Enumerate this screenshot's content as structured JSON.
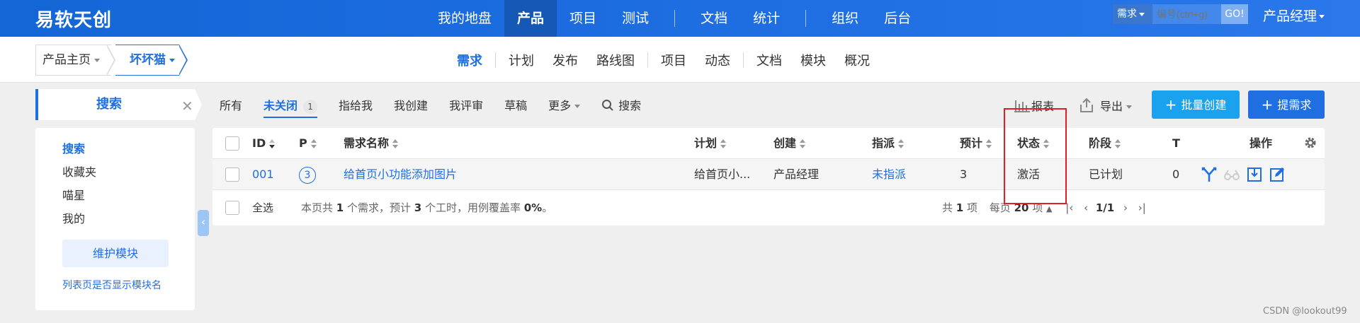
{
  "brand": "易软天创",
  "top_nav": {
    "items": [
      "我的地盘",
      "产品",
      "项目",
      "测试",
      "文档",
      "统计",
      "组织",
      "后台"
    ],
    "active": "产品"
  },
  "quick_search": {
    "type": "需求",
    "placeholder": "编号(ctrl+g)",
    "go": "GO!"
  },
  "user_menu": "产品经理",
  "breadcrumb": {
    "home": "产品主页",
    "product": "坏坏猫"
  },
  "sub_nav": {
    "items": [
      "需求",
      "计划",
      "发布",
      "路线图",
      "项目",
      "动态",
      "文档",
      "模块",
      "概况"
    ],
    "active": "需求"
  },
  "sidebar": {
    "header": "搜索",
    "items": [
      "搜索",
      "收藏夹",
      "喵星",
      "我的"
    ],
    "active": "搜索",
    "maintain_button": "维护模块",
    "toggle_link": "列表页是否显示模块名"
  },
  "filters": {
    "tabs": [
      "所有",
      "未关闭",
      "指给我",
      "我创建",
      "我评审",
      "草稿",
      "更多"
    ],
    "active": "未关闭",
    "unclosed_count": "1",
    "search": "搜索"
  },
  "toolbar": {
    "report": "报表",
    "export": "导出",
    "batch_create": "批量创建",
    "new_story": "提需求"
  },
  "table": {
    "columns": {
      "id": "ID",
      "pri": "P",
      "title": "需求名称",
      "plan": "计划",
      "opened_by": "创建",
      "assigned_to": "指派",
      "estimate": "预计",
      "status": "状态",
      "stage": "阶段",
      "t": "T",
      "actions": "操作"
    },
    "rows": [
      {
        "id": "001",
        "pri": "3",
        "title": "给首页小功能添加图片",
        "plan": "给首页小...",
        "opened_by": "产品经理",
        "assigned_to": "未指派",
        "estimate": "3",
        "status": "激活",
        "stage": "已计划",
        "t": "0"
      }
    ],
    "footer": {
      "select_all": "全选",
      "summary_pre": "本页共 ",
      "summary_count": "1",
      "summary_mid1": " 个需求，预计 ",
      "summary_hours": "3",
      "summary_mid2": " 个工时，用例覆盖率 ",
      "summary_rate": "0%",
      "summary_end": "。",
      "total_pre": "共 ",
      "total": "1",
      "total_post": " 项",
      "per_page_pre": "每页 ",
      "per_page": "20",
      "per_page_post": " 项",
      "page": "1/1"
    }
  },
  "watermark": "CSDN @lookout99",
  "colors": {
    "primary": "#1f6fe3",
    "secondary": "#1aa2ef",
    "highlight_box": "#e02020"
  }
}
